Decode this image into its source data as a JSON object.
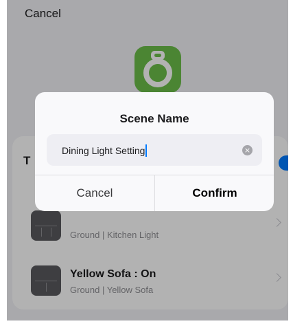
{
  "nav": {
    "cancel_label": "Cancel"
  },
  "app_icon": {
    "name": "light-bulb-icon",
    "color": "#6cbf4a"
  },
  "scene_card": {
    "title_fragment": "T",
    "rows": [
      {
        "title": "",
        "subtitle": "Ground  | Kitchen Light"
      },
      {
        "title": "Yellow Sofa : On",
        "subtitle": "Ground  | Yellow Sofa"
      }
    ]
  },
  "dialog": {
    "title": "Scene Name",
    "input_value": "Dining Light Setting",
    "clear_icon": "×",
    "cancel_label": "Cancel",
    "confirm_label": "Confirm"
  },
  "colors": {
    "accent": "#007aff",
    "background": "#f2f2f7"
  }
}
